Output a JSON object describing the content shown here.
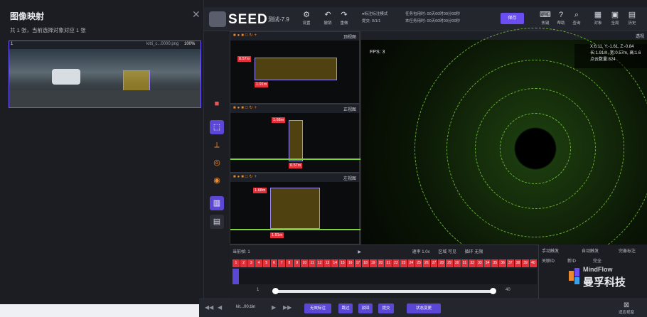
{
  "left_panel": {
    "title": "图像映射",
    "count_text": "共 1 张，当前选择对象对应 1 张",
    "thumb": {
      "index": "1",
      "name": "kitti_c...0000.png",
      "zoom": "100%"
    }
  },
  "topbar": {
    "brand": "SEED",
    "project": "测试-7.9",
    "buttons": [
      "设置",
      "撤销",
      "重做"
    ],
    "mode_lines": [
      "●标注标注模式",
      "提交: 0/1/1"
    ],
    "timer_lines": [
      "任务包用时: 00天00时00分00秒",
      "本任务用时: 00天00时00分00秒"
    ],
    "save": "保存",
    "right_buttons": [
      "热键",
      "帮助",
      "查询",
      "对象",
      "全局",
      "历史"
    ]
  },
  "panes": [
    {
      "tag": "顶视图",
      "m1": "0.57m",
      "m2": "1.91m"
    },
    {
      "tag": "正视图",
      "m1": "1.68m",
      "m2": "0.57m"
    },
    {
      "tag": "左视图",
      "m1": "1.68m",
      "m2": "1.91m"
    }
  ],
  "bigview": {
    "tag": "透视",
    "fps": "FPS: 3",
    "info": [
      "X:6.11, Y:-1.61, Z:-0.84",
      "长:1.91m, 宽:0.57m, 高:1.6",
      "点云数量:824"
    ]
  },
  "timeline": {
    "current_frame": "当前帧: 1",
    "speed": "速率 1.0x",
    "section": "区域 可见",
    "loop": "循环 无限",
    "frames": [
      "1",
      "2",
      "3",
      "4",
      "5",
      "6",
      "7",
      "8",
      "9",
      "10",
      "11",
      "12",
      "13",
      "14",
      "15",
      "16",
      "17",
      "18",
      "19",
      "20",
      "21",
      "22",
      "23",
      "24",
      "25",
      "26",
      "27",
      "28",
      "29",
      "30",
      "31",
      "32",
      "33",
      "34",
      "35",
      "36",
      "37",
      "38",
      "39",
      "40"
    ],
    "slider_start": "1",
    "slider_end": "40",
    "slider_value": 0.02
  },
  "right_bottom": {
    "lines": [
      "手动触发",
      "自动触发",
      "完善标注",
      "关联ID",
      "新ID",
      "完全"
    ],
    "mindflow": "MindFlow",
    "company": "曼孚科技"
  },
  "footer": {
    "file": "kit...00.bin",
    "buttons": [
      "无效标注",
      "跳过",
      "驳回",
      "提交"
    ],
    "status": "状态变更",
    "right": "适应视窗"
  }
}
